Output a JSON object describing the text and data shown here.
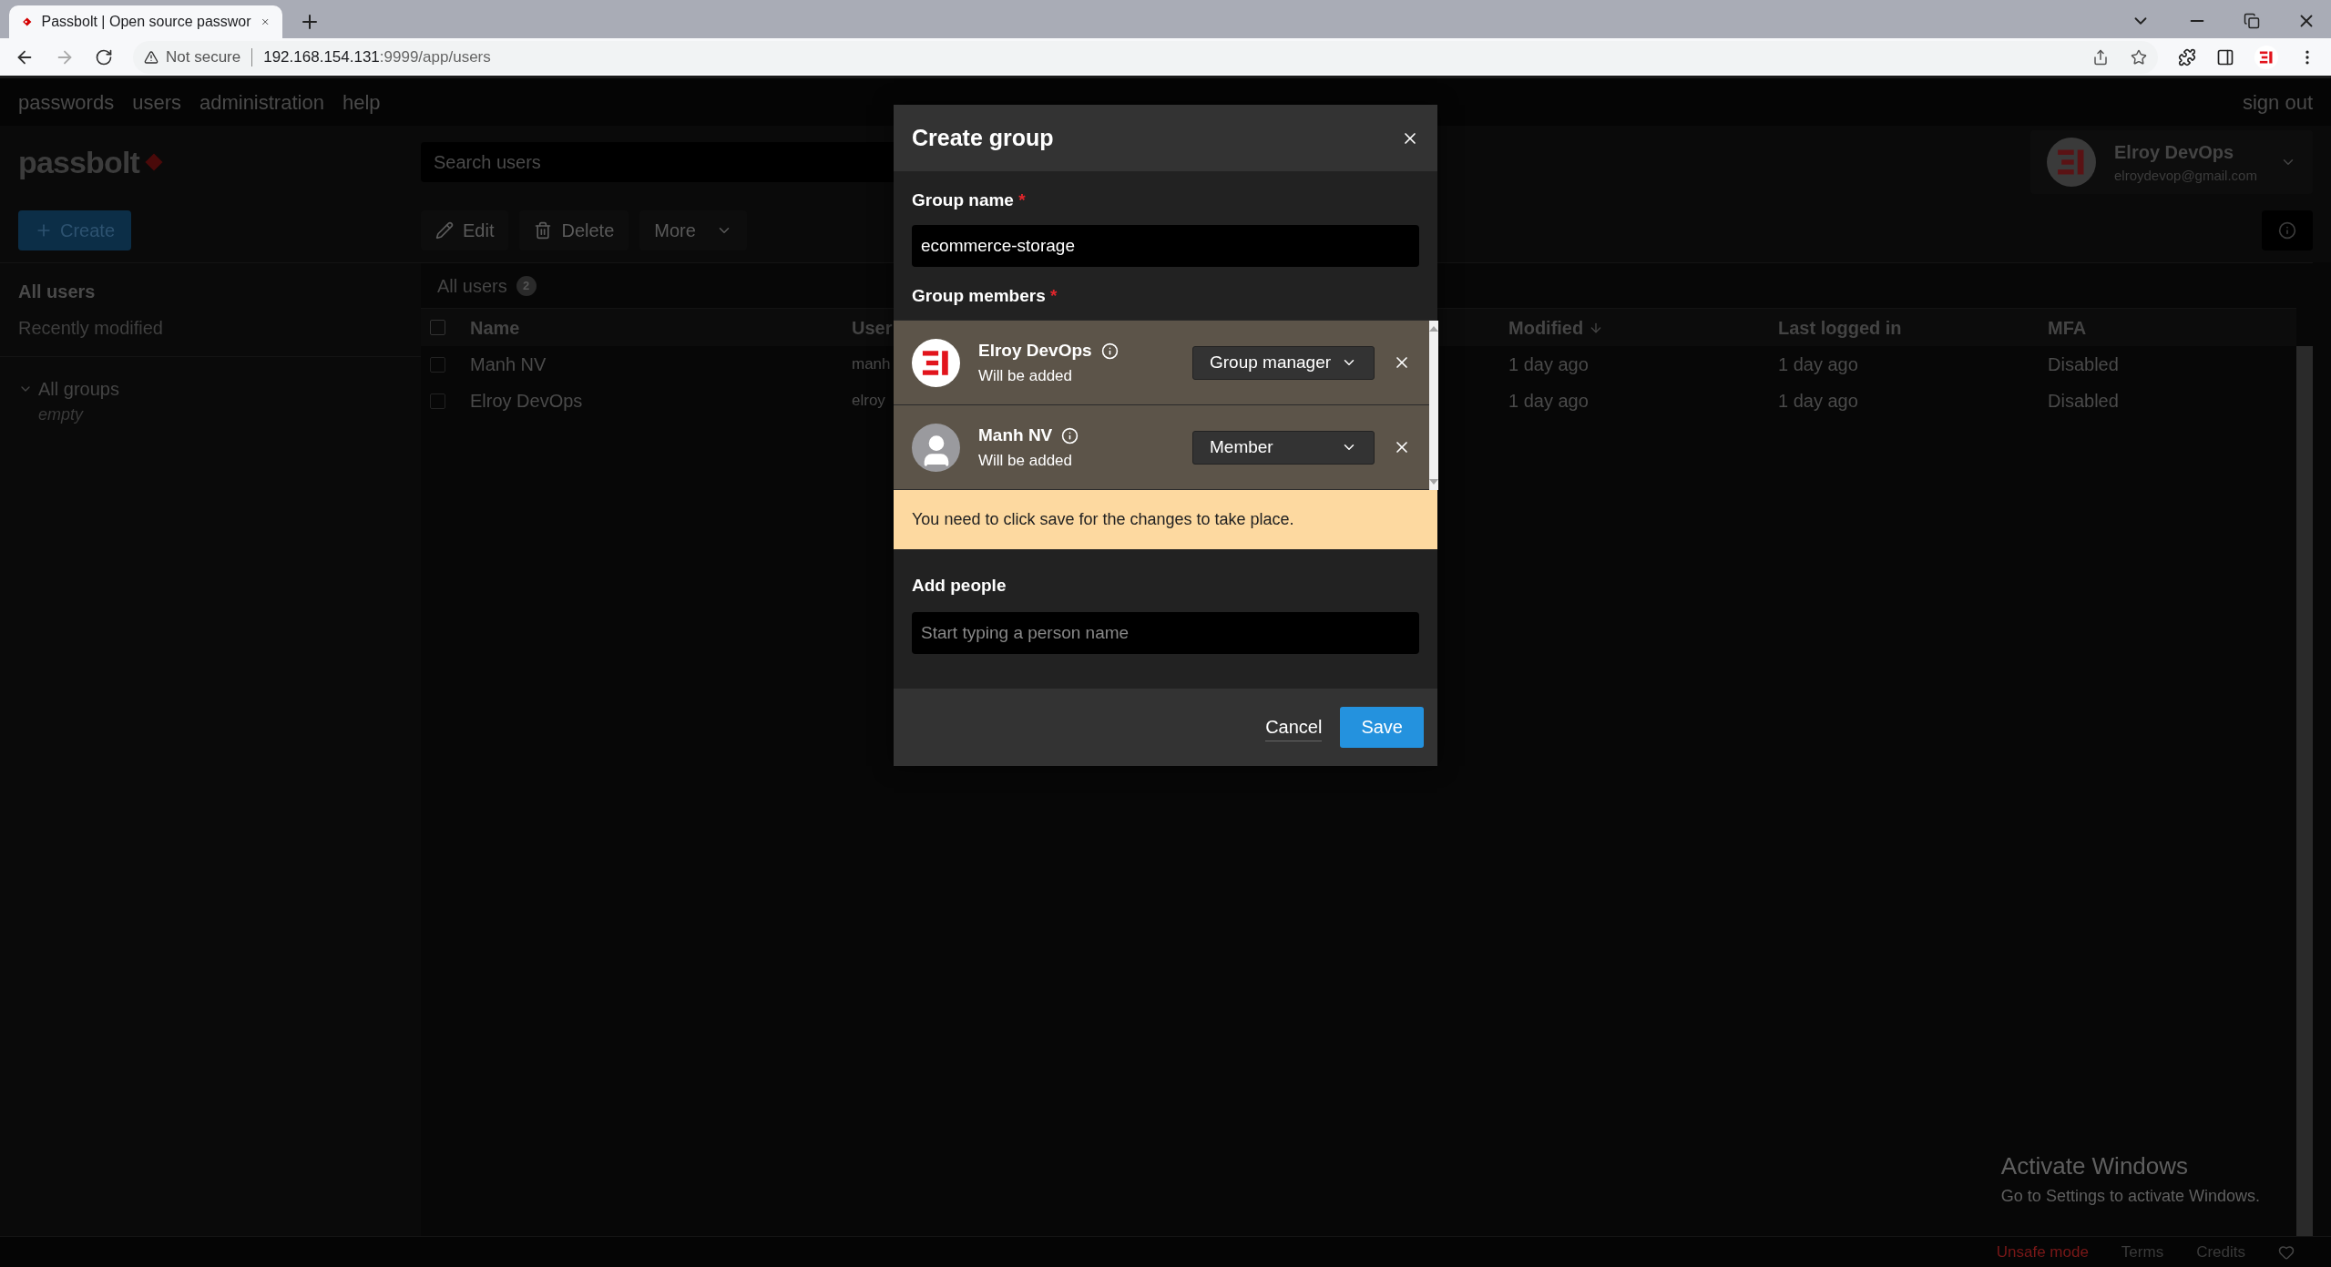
{
  "browser": {
    "tab_title": "Passbolt | Open source passwor",
    "not_secure": "Not secure",
    "url_host": "192.168.154.131",
    "url_path": ":9999/app/users"
  },
  "nav": {
    "items": [
      "passwords",
      "users",
      "administration",
      "help"
    ],
    "sign_out": "sign out"
  },
  "logo": "passbolt",
  "search": {
    "placeholder": "Search users"
  },
  "create_button": "Create",
  "toolbar": [
    {
      "label": "Edit",
      "kind": "edit"
    },
    {
      "label": "Delete",
      "kind": "delete"
    },
    {
      "label": "More",
      "kind": "more"
    }
  ],
  "user_card": {
    "name": "Elroy DevOps",
    "email": "elroydevop@gmail.com"
  },
  "sidebar": {
    "filters": [
      {
        "label": "All users",
        "selected": true
      },
      {
        "label": "Recently modified",
        "selected": false
      }
    ],
    "groups": {
      "label": "All groups",
      "expanded": true,
      "empty_text": "empty"
    }
  },
  "breadcrumb": {
    "label": "All users",
    "count": "2"
  },
  "table": {
    "all_checked": false,
    "columns": [
      {
        "label": "Name",
        "sorted": false
      },
      {
        "label": "User",
        "sorted": false
      },
      {
        "label": "Modified",
        "sorted": true
      },
      {
        "label": "Last logged in",
        "sorted": false
      },
      {
        "label": "MFA",
        "sorted": false
      }
    ],
    "rows": [
      {
        "checked": false,
        "cells": [
          "Manh NV",
          "manh",
          "1 day ago",
          "1 day ago",
          "Disabled"
        ]
      },
      {
        "checked": false,
        "cells": [
          "Elroy DevOps",
          "elroy",
          "1 day ago",
          "1 day ago",
          "Disabled"
        ]
      }
    ]
  },
  "footer": {
    "unsafe": "Unsafe mode",
    "links": [
      "Terms",
      "Credits"
    ]
  },
  "os_notice": {
    "title": "Activate Windows",
    "text": "Go to Settings to activate Windows."
  },
  "dialog": {
    "title": "Create group",
    "group_name_label": "Group name",
    "required_mark": "*",
    "group_name_value": "ecommerce-storage",
    "members_label": "Group members",
    "members": [
      {
        "name": "Elroy DevOps",
        "status": "Will be added",
        "role": "Group manager",
        "kind": "logo"
      },
      {
        "name": "Manh NV",
        "status": "Will be added",
        "role": "Member",
        "kind": "default"
      }
    ],
    "warning": "You need to click save for the changes to take place.",
    "add_people_label": "Add people",
    "add_people_placeholder": "Start typing a person name",
    "cancel": "Cancel",
    "save": "Save"
  }
}
